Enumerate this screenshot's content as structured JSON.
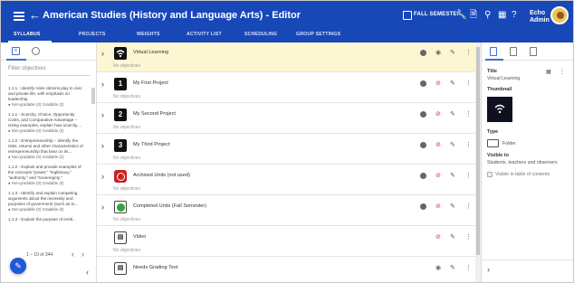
{
  "header": {
    "title": "American Studies (History and Language Arts) - Editor",
    "term": "FALL SEMESTER",
    "user_line1": "Echo",
    "user_line2": "Admin",
    "icons": [
      "menu-icon",
      "back-arrow-icon",
      "calendar-icon",
      "wrench-icon",
      "document-icon",
      "search-icon",
      "grid-icon",
      "help-icon"
    ]
  },
  "tabs": [
    "SYLLABUS",
    "PROJECTS",
    "WEIGHTS",
    "ACTIVITY LIST",
    "SCHEDULING",
    "GROUP SETTINGS"
  ],
  "left": {
    "filter_placeholder": "Filter objectives",
    "objectives": [
      {
        "title": "1.1.1 - Identify roles citizens play in civic and private life, with emphasis on leadership.",
        "meta": "Non-gradable (0)  Gradable (2)"
      },
      {
        "title": "1.1.1 - Scarcity, Choice, Opportunity Costs, and Comparative Advantage – Using examples, explain how scarcity,...",
        "meta": "Non-gradable (0)  Gradable (2)"
      },
      {
        "title": "1.1.2 - Entrepreneurship – Identify the risks, returns and other characteristics of entrepreneurship that bear on its...",
        "meta": "Non-gradable (0)  Gradable (2)"
      },
      {
        "title": "1.1.2 - Explain and provide examples of the concepts \"power,\" \"legitimacy,\" \"authority,\" and \"sovereignty.\"",
        "meta": "Non-gradable (0)  Gradable (0)"
      },
      {
        "title": "1.1.3 - Identify and explain competing arguments about the necessity and purposes of government (such as to...",
        "meta": "Non-gradable (0)  Gradable (0)"
      },
      {
        "title": "1.1.3 - Explain the purpose of entitl...",
        "meta": ""
      }
    ],
    "pager": "1 – 10 of 344"
  },
  "rows": [
    {
      "name": "Virtual Learning",
      "sub": "No objectives",
      "icon": "wifi-icon",
      "highlight": true,
      "minus": true,
      "eye_hidden": false,
      "has_pencil": true
    },
    {
      "name": "My First Project",
      "sub": "No objectives",
      "icon": "number-1-icon",
      "highlight": false,
      "minus": true,
      "eye_hidden": true,
      "has_pencil": true
    },
    {
      "name": "My Second Project",
      "sub": "No objectives",
      "icon": "number-2-icon",
      "highlight": false,
      "minus": true,
      "eye_hidden": true,
      "has_pencil": true
    },
    {
      "name": "My Third Project",
      "sub": "No objectives",
      "icon": "number-3-icon",
      "highlight": false,
      "minus": true,
      "eye_hidden": true,
      "has_pencil": true
    },
    {
      "name": "Archived Units (not used)",
      "sub": "No objectives",
      "icon": "no-entry-icon",
      "highlight": false,
      "minus": true,
      "eye_hidden": true,
      "has_pencil": true
    },
    {
      "name": "Completed Units (Fall Semester)",
      "sub": "No objectives",
      "icon": "check-icon",
      "highlight": false,
      "minus": true,
      "eye_hidden": true,
      "has_pencil": true
    },
    {
      "name": "Video",
      "sub": "No objectives",
      "icon": "document-icon",
      "highlight": false,
      "minus": false,
      "eye_hidden": true,
      "has_pencil": true
    },
    {
      "name": "Needs Grading Test",
      "sub": "",
      "icon": "document-icon",
      "highlight": false,
      "minus": false,
      "eye_hidden": false,
      "has_pencil": true
    }
  ],
  "row_numbers": {
    "1": "1",
    "2": "2",
    "3": "3"
  },
  "right": {
    "title_label": "Title",
    "title_value": "Virtual Learning",
    "thumbnail_label": "Thumbnail",
    "type_label": "Type",
    "type_value": "Folder",
    "visible_label": "Visible to",
    "visible_value": "Students, teachers and observers",
    "toc_label": "Visible in table of contents"
  },
  "colors": {
    "header": "#1848b8",
    "accent": "#3b6fe0",
    "highlight": "#fdf6d2",
    "hidden_eye": "#d33333"
  }
}
